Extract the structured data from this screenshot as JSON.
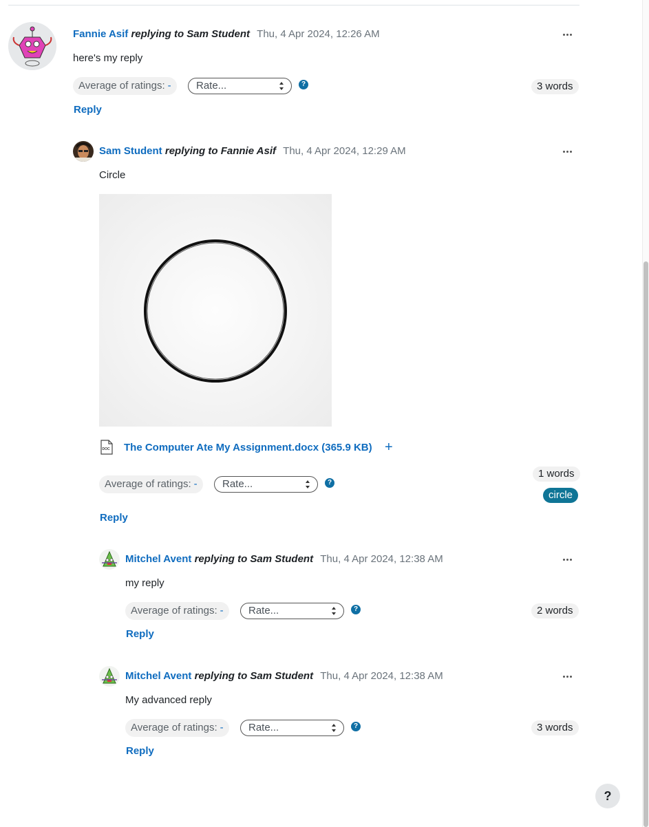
{
  "colors": {
    "link": "#0f6cbf",
    "tag_bg": "#0f7596",
    "help_icon": "#0f6fa4"
  },
  "posts": [
    {
      "author": "Fannie Asif",
      "replying": "replying to Sam Student",
      "date": "Thu, 4 Apr 2024, 12:26 AM",
      "message": "here's my reply",
      "avg_label": "Average of ratings:",
      "avg_value": "-",
      "rate_placeholder": "Rate...",
      "help": "?",
      "words": "3 words",
      "reply": "Reply"
    },
    {
      "author": "Sam Student",
      "replying": "replying to Fannie Asif",
      "date": "Thu, 4 Apr 2024, 12:29 AM",
      "message": "Circle",
      "attachment": "The Computer Ate My Assignment.docx (365.9 KB)",
      "avg_label": "Average of ratings:",
      "avg_value": "-",
      "rate_placeholder": "Rate...",
      "help": "?",
      "words": "1 words",
      "tag": "circle",
      "reply": "Reply"
    },
    {
      "author": "Mitchel Avent",
      "replying": "replying to Sam Student",
      "date": "Thu, 4 Apr 2024, 12:38 AM",
      "message": "my reply",
      "avg_label": "Average of ratings:",
      "avg_value": "-",
      "rate_placeholder": "Rate...",
      "help": "?",
      "words": "2 words",
      "reply": "Reply"
    },
    {
      "author": "Mitchel Avent",
      "replying": "replying to Sam Student",
      "date": "Thu, 4 Apr 2024, 12:38 AM",
      "message": "My advanced reply",
      "avg_label": "Average of ratings:",
      "avg_value": "-",
      "rate_placeholder": "Rate...",
      "help": "?",
      "words": "3 words",
      "reply": "Reply"
    }
  ],
  "help_button": "?"
}
